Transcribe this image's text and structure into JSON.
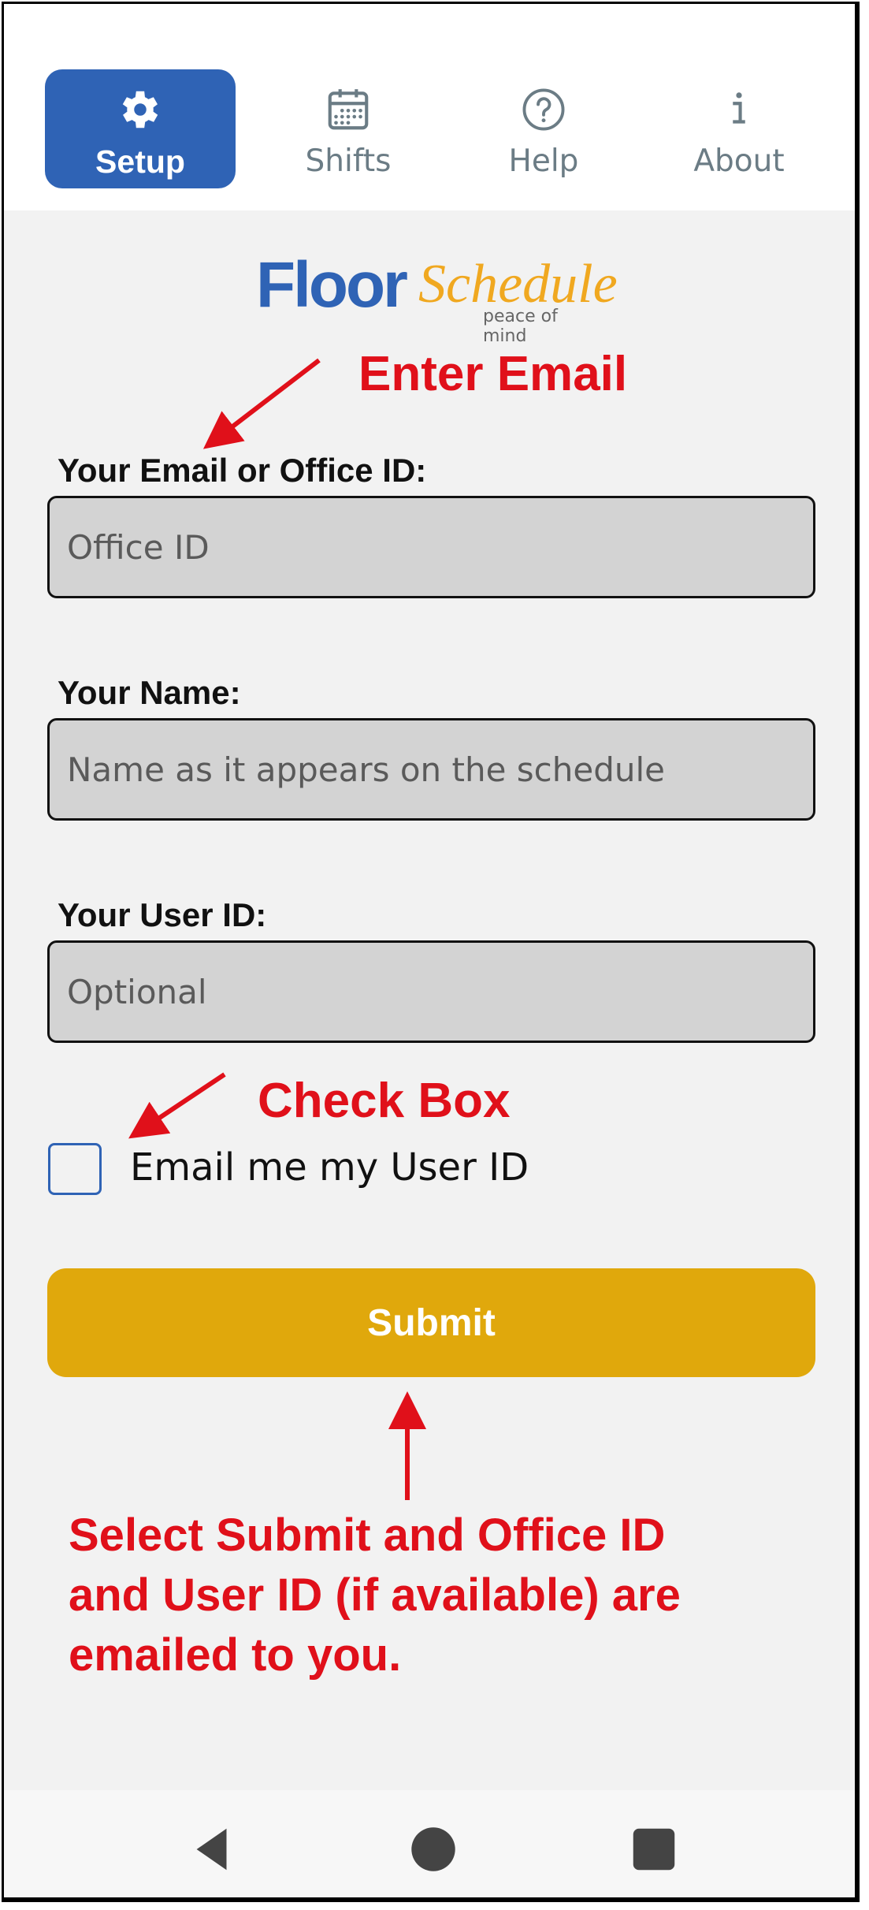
{
  "tabs": [
    {
      "label": "Setup",
      "icon": "gear-icon",
      "active": true
    },
    {
      "label": "Shifts",
      "icon": "calendar-icon",
      "active": false
    },
    {
      "label": "Help",
      "icon": "help-circle-icon",
      "active": false
    },
    {
      "label": "About",
      "icon": "info-icon",
      "active": false
    }
  ],
  "logo": {
    "floor": "Floor",
    "schedule": "Schedule",
    "tagline": "peace of mind"
  },
  "annotations": {
    "enter_email": "Enter Email",
    "check_box": "Check Box",
    "submit_note_line1": "Select Submit and Office ID",
    "submit_note_line2": "and User ID (if available) are",
    "submit_note_line3": "emailed to you."
  },
  "form": {
    "email_label": "Your Email or Office ID:",
    "email_placeholder": "Office ID",
    "name_label": "Your Name:",
    "name_placeholder": "Name as it appears on the schedule",
    "userid_label": "Your User ID:",
    "userid_placeholder": "Optional",
    "checkbox_label": "Email me my User ID",
    "checkbox_checked": false,
    "submit_label": "Submit"
  },
  "colors": {
    "active_tab": "#2f63b5",
    "submit": "#e0a80c",
    "annotation": "#e0101a"
  }
}
